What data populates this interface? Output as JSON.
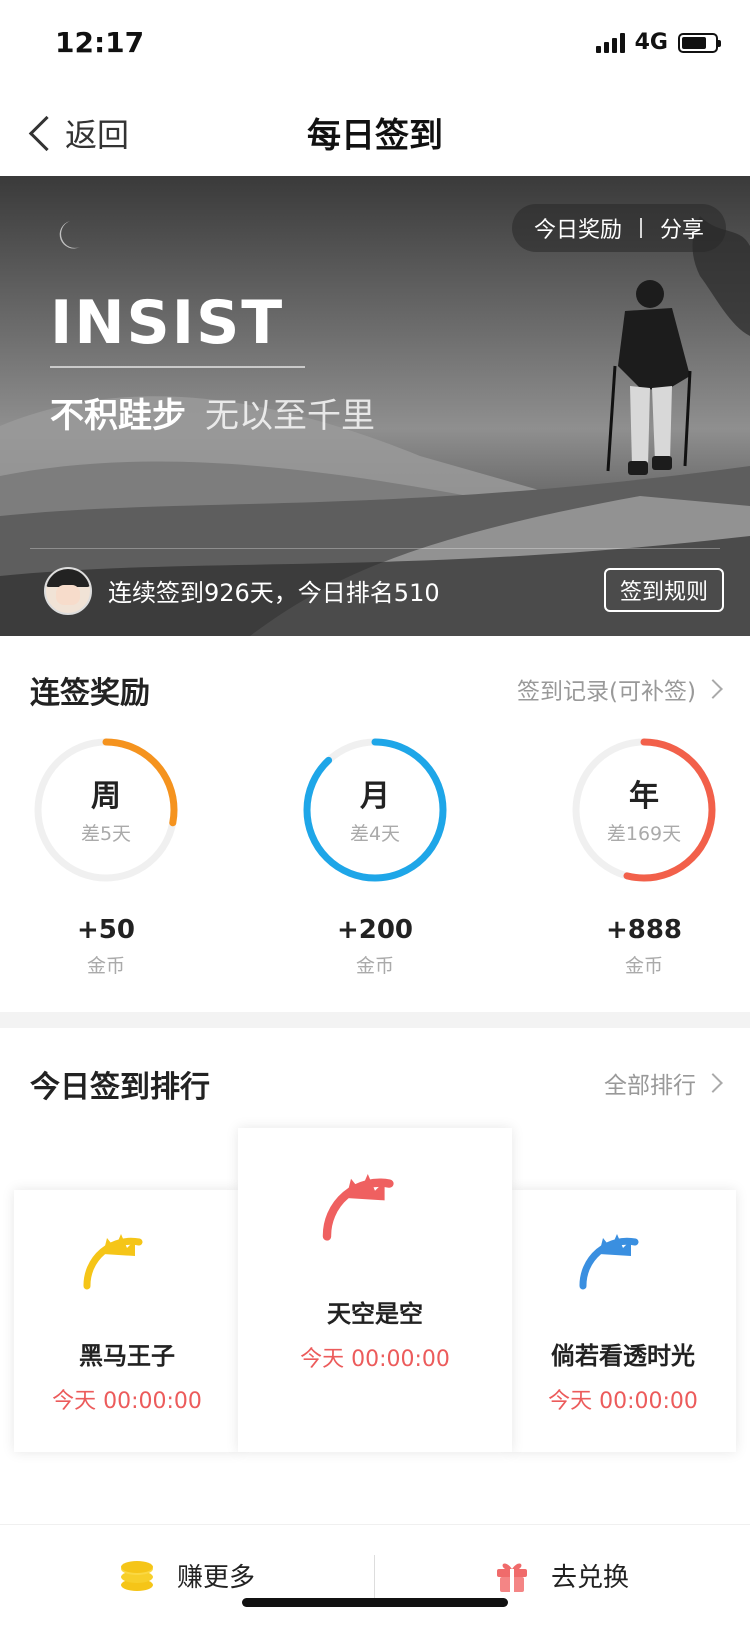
{
  "status_bar": {
    "time": "12:17",
    "network": "4G",
    "battery_level": 0.75
  },
  "nav": {
    "back_label": "返回",
    "title": "每日签到"
  },
  "banner": {
    "pill_left": "今日奖励",
    "pill_right": "分享",
    "headline": "INSIST",
    "motto_bold": "不积跬步",
    "motto_light": "无以至千里",
    "streak_text": "连续签到926天，今日排名510",
    "rules_label": "签到规则"
  },
  "rewards": {
    "title": "连签奖励",
    "link": "签到记录(可补签)",
    "items": [
      {
        "period": "周",
        "remaining": "差5天",
        "reward": "+50",
        "unit": "金币",
        "color": "#f5931e",
        "progress": 0.28
      },
      {
        "period": "月",
        "remaining": "差4天",
        "reward": "+200",
        "unit": "金币",
        "color": "#1ea6e8",
        "progress": 0.88
      },
      {
        "period": "年",
        "remaining": "差169天",
        "reward": "+888",
        "unit": "金币",
        "color": "#f2604a",
        "progress": 0.54
      }
    ]
  },
  "ranking": {
    "title": "今日签到排行",
    "link": "全部排行",
    "entries": [
      {
        "name": "黑马王子",
        "time": "今天 00:00:00",
        "crown_color": "#f5c518"
      },
      {
        "name": "天空是空",
        "time": "今天 00:00:00",
        "crown_color": "#ef6060"
      },
      {
        "name": "倘若看透时光",
        "time": "今天 00:00:00",
        "crown_color": "#3a8fe0"
      }
    ]
  },
  "bottom_bar": {
    "earn_label": "赚更多",
    "redeem_label": "去兑换"
  }
}
